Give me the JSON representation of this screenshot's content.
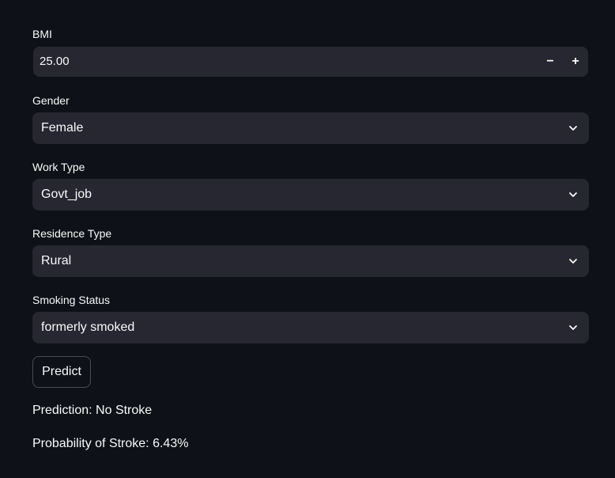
{
  "bmi": {
    "label": "BMI",
    "value": "25.00",
    "decrement_label": "−",
    "increment_label": "+"
  },
  "gender": {
    "label": "Gender",
    "selected": "Female"
  },
  "work_type": {
    "label": "Work Type",
    "selected": "Govt_job"
  },
  "residence_type": {
    "label": "Residence Type",
    "selected": "Rural"
  },
  "smoking_status": {
    "label": "Smoking Status",
    "selected": "formerly smoked"
  },
  "predict_button": {
    "label": "Predict"
  },
  "results": {
    "prediction": "Prediction: No Stroke",
    "probability": "Probability of Stroke: 6.43%"
  },
  "colors": {
    "background": "#0e1117",
    "input_background": "#262730",
    "text": "#fafafa"
  }
}
